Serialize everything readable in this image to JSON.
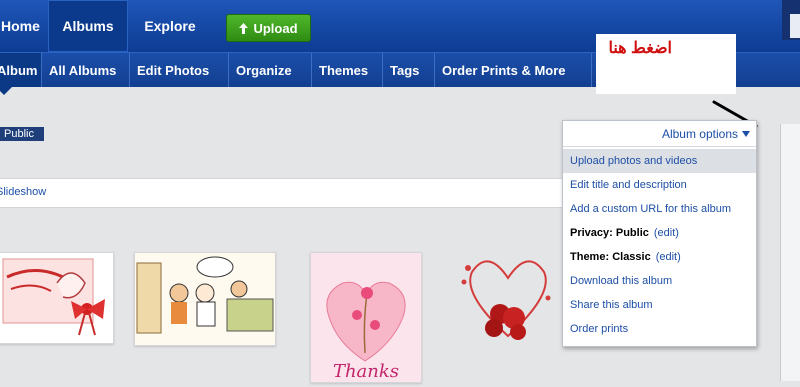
{
  "topnav": {
    "home": "Home",
    "albums": "Albums",
    "explore": "Explore",
    "upload": "Upload"
  },
  "subnav": {
    "tabs": [
      "Album",
      "All Albums",
      "Edit Photos",
      "Organize",
      "Themes",
      "Tags",
      "Order Prints & More"
    ]
  },
  "annotation": {
    "text": "اضغط هنا"
  },
  "album": {
    "privacy_badge": "Public",
    "slideshow": "Slideshow"
  },
  "dropdown": {
    "header": "Album options",
    "header_icon": "triangle-down-icon",
    "items": [
      "Upload photos and videos",
      "Edit title and description",
      "Add a custom URL for this album",
      {
        "label": "Privacy:",
        "value": "Public",
        "edit": "(edit)"
      },
      {
        "label": "Theme:",
        "value": "Classic",
        "edit": "(edit)"
      },
      "Download this album",
      "Share this album",
      "Order prints"
    ]
  },
  "thumbnails": [
    "card-arabic-bow",
    "cartoon-office",
    "thanks-card",
    "roses-heart"
  ],
  "colors": {
    "nav": "#1f56b8",
    "nav_dark": "#0b3a8c",
    "upload_green": "#3ea11f",
    "link": "#1d4fa6",
    "annotation_red": "#d01010"
  }
}
